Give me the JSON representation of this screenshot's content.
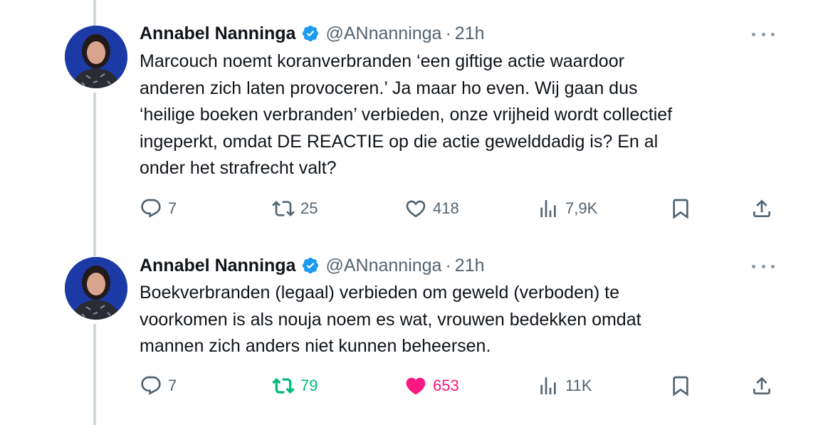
{
  "tweets": [
    {
      "author": {
        "name": "Annabel Nanninga",
        "handle": "@ANnanninga",
        "verified": true
      },
      "dot": "·",
      "time": "21h",
      "text": "Marcouch noemt koranverbranden ‘een giftige actie waardoor\nanderen zich laten provoceren.’ Ja maar ho even. Wij gaan dus\n‘heilige boeken verbranden’ verbieden, onze vrijheid wordt collectief\ningeperkt, omdat DE REACTIE op die actie gewelddadig is? En al\nonder het strafrecht valt?",
      "replies": "7",
      "reposts": "25",
      "likes": "418",
      "views": "7,9K",
      "reposted": false,
      "liked": false
    },
    {
      "author": {
        "name": "Annabel Nanninga",
        "handle": "@ANnanninga",
        "verified": true
      },
      "dot": "·",
      "time": "21h",
      "text": "Boekverbranden (legaal) verbieden om geweld (verboden) te\nvoorkomen is als nouja noem es wat, vrouwen bedekken omdat\nmannen zich anders niet kunnen beheersen.",
      "replies": "7",
      "reposts": "79",
      "likes": "653",
      "views": "11K",
      "reposted": true,
      "liked": true
    }
  ],
  "colors": {
    "text": "#0f1419",
    "secondary": "#536471",
    "verified": "#1d9bf0",
    "repost_active": "#00ba7c",
    "like_active": "#f91880",
    "thread_line": "#cfd9de"
  }
}
